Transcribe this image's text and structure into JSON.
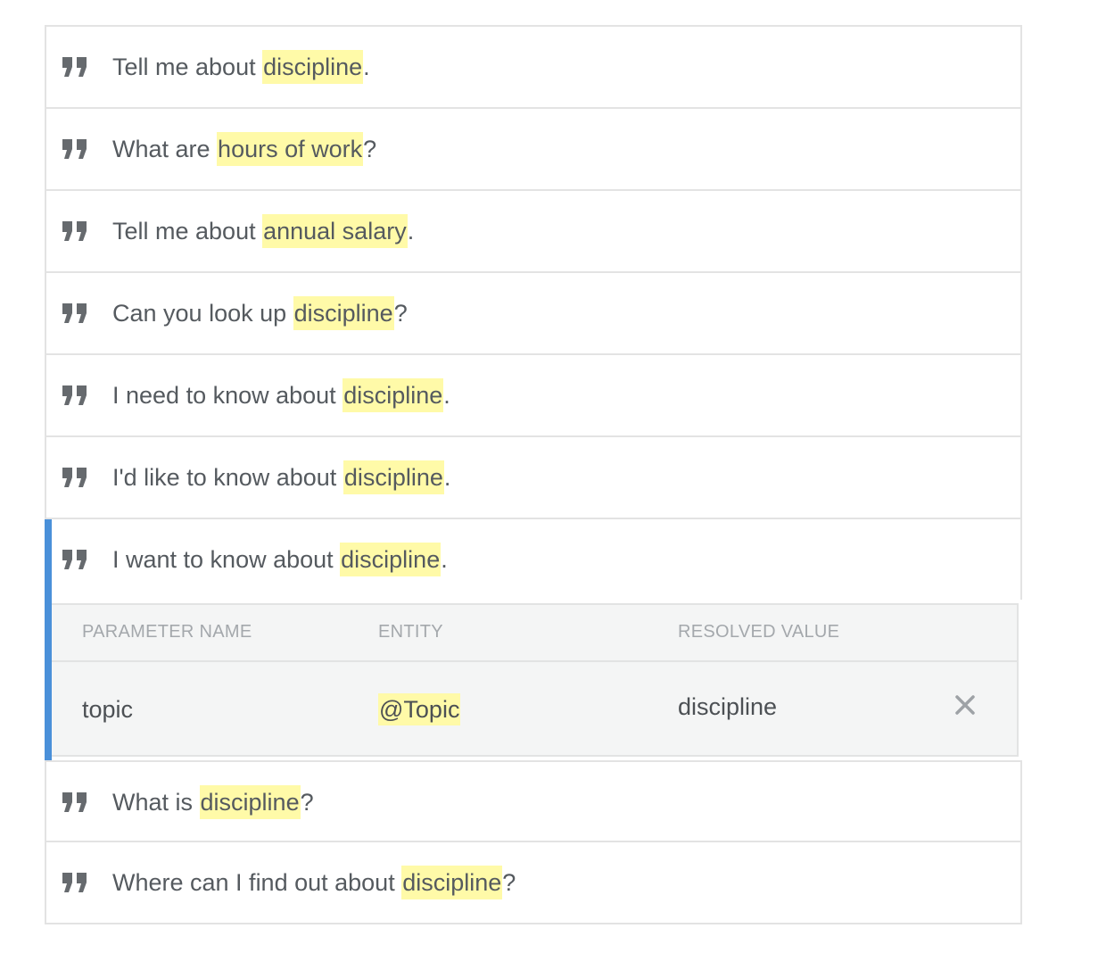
{
  "phrases": [
    {
      "before": "Tell me about ",
      "entity": "discipline",
      "after": "."
    },
    {
      "before": "What are ",
      "entity": "hours of work",
      "after": "?"
    },
    {
      "before": "Tell me about ",
      "entity": "annual salary",
      "after": "."
    },
    {
      "before": "Can you look up ",
      "entity": "discipline",
      "after": "?"
    },
    {
      "before": "I need to know about ",
      "entity": "discipline",
      "after": "."
    },
    {
      "before": "I'd like to know about ",
      "entity": "discipline",
      "after": "."
    },
    {
      "before": "I want to know about ",
      "entity": "discipline",
      "after": "."
    },
    {
      "before": "What is ",
      "entity": "discipline",
      "after": "?"
    },
    {
      "before": "Where can I find out about ",
      "entity": "discipline",
      "after": "?"
    }
  ],
  "selected_index": 6,
  "parameters": {
    "headers": {
      "name": "PARAMETER NAME",
      "entity": "ENTITY",
      "value": "RESOLVED VALUE"
    },
    "row": {
      "name": "topic",
      "entity": "@Topic",
      "value": "discipline"
    }
  },
  "icons": {
    "phrase_icon": "quote-icon",
    "delete_icon": "close-icon"
  },
  "colors": {
    "highlight": "#fffaa8",
    "selected_accent": "#4a90d9",
    "border": "#e3e3e3",
    "panel_bg": "#f4f5f5"
  }
}
